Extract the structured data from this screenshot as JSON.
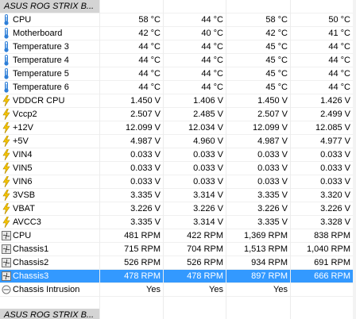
{
  "groups": [
    {
      "title": "ASUS ROG STRIX B...",
      "rows": [
        {
          "label": "CPU",
          "icon": "thermometer-icon",
          "v": [
            "58 °C",
            "44 °C",
            "58 °C",
            "50 °C"
          ]
        },
        {
          "label": "Motherboard",
          "icon": "thermometer-icon",
          "v": [
            "42 °C",
            "40 °C",
            "42 °C",
            "41 °C"
          ]
        },
        {
          "label": "Temperature 3",
          "icon": "thermometer-icon",
          "v": [
            "44 °C",
            "44 °C",
            "45 °C",
            "44 °C"
          ]
        },
        {
          "label": "Temperature 4",
          "icon": "thermometer-icon",
          "v": [
            "44 °C",
            "44 °C",
            "45 °C",
            "44 °C"
          ]
        },
        {
          "label": "Temperature 5",
          "icon": "thermometer-icon",
          "v": [
            "44 °C",
            "44 °C",
            "45 °C",
            "44 °C"
          ]
        },
        {
          "label": "Temperature 6",
          "icon": "thermometer-icon",
          "v": [
            "44 °C",
            "44 °C",
            "45 °C",
            "44 °C"
          ]
        },
        {
          "label": "VDDCR CPU",
          "icon": "lightning-icon",
          "v": [
            "1.450 V",
            "1.406 V",
            "1.450 V",
            "1.426 V"
          ]
        },
        {
          "label": "Vccp2",
          "icon": "lightning-icon",
          "v": [
            "2.507 V",
            "2.485 V",
            "2.507 V",
            "2.499 V"
          ]
        },
        {
          "label": "+12V",
          "icon": "lightning-icon",
          "v": [
            "12.099 V",
            "12.034 V",
            "12.099 V",
            "12.085 V"
          ]
        },
        {
          "label": "+5V",
          "icon": "lightning-icon",
          "v": [
            "4.987 V",
            "4.960 V",
            "4.987 V",
            "4.977 V"
          ]
        },
        {
          "label": "VIN4",
          "icon": "lightning-icon",
          "v": [
            "0.033 V",
            "0.033 V",
            "0.033 V",
            "0.033 V"
          ]
        },
        {
          "label": "VIN5",
          "icon": "lightning-icon",
          "v": [
            "0.033 V",
            "0.033 V",
            "0.033 V",
            "0.033 V"
          ]
        },
        {
          "label": "VIN6",
          "icon": "lightning-icon",
          "v": [
            "0.033 V",
            "0.033 V",
            "0.033 V",
            "0.033 V"
          ]
        },
        {
          "label": "3VSB",
          "icon": "lightning-icon",
          "v": [
            "3.335 V",
            "3.314 V",
            "3.335 V",
            "3.320 V"
          ]
        },
        {
          "label": "VBAT",
          "icon": "lightning-icon",
          "v": [
            "3.226 V",
            "3.226 V",
            "3.226 V",
            "3.226 V"
          ]
        },
        {
          "label": "AVCC3",
          "icon": "lightning-icon",
          "v": [
            "3.335 V",
            "3.314 V",
            "3.335 V",
            "3.328 V"
          ]
        },
        {
          "label": "CPU",
          "icon": "fan-icon",
          "v": [
            "481 RPM",
            "422 RPM",
            "1,369 RPM",
            "838 RPM"
          ]
        },
        {
          "label": "Chassis1",
          "icon": "fan-icon",
          "v": [
            "715 RPM",
            "704 RPM",
            "1,513 RPM",
            "1,040 RPM"
          ]
        },
        {
          "label": "Chassis2",
          "icon": "fan-icon",
          "v": [
            "526 RPM",
            "526 RPM",
            "934 RPM",
            "691 RPM"
          ]
        },
        {
          "label": "Chassis3",
          "icon": "fan-icon",
          "selected": true,
          "v": [
            "478 RPM",
            "478 RPM",
            "897 RPM",
            "666 RPM"
          ]
        },
        {
          "label": "Chassis Intrusion",
          "icon": "clock-icon",
          "v": [
            "Yes",
            "Yes",
            "Yes",
            ""
          ]
        }
      ]
    },
    {
      "title": "ASUS ROG STRIX B...",
      "rows": []
    }
  ],
  "colors": {
    "selection": "#3399ff",
    "header_bg": "#d4d4d4",
    "thermo": "#2e7fd8",
    "lightning": "#f5c400",
    "fan": "#606060"
  }
}
